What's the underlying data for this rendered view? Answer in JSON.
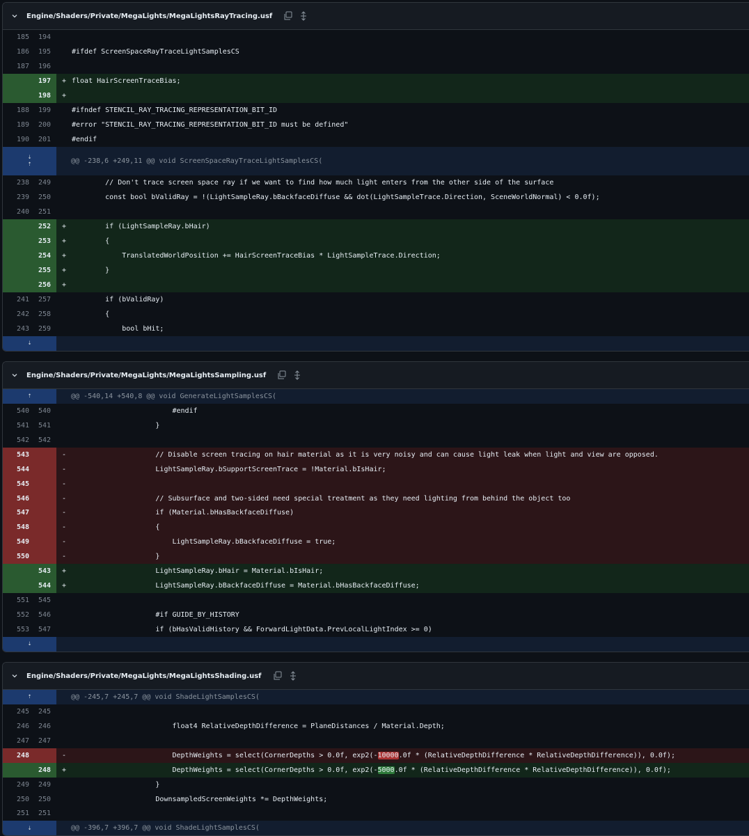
{
  "files": [
    {
      "name": "Engine/Shaders/Private/MegaLights/MegaLightsRayTracing.usf",
      "rows": [
        {
          "t": "ctx",
          "o": "185",
          "n": "194",
          "s": "",
          "c": ""
        },
        {
          "t": "ctx",
          "o": "186",
          "n": "195",
          "s": "",
          "c": "#ifdef ScreenSpaceRayTraceLightSamplesCS"
        },
        {
          "t": "ctx",
          "o": "187",
          "n": "196",
          "s": "",
          "c": ""
        },
        {
          "t": "add",
          "o": "",
          "n": "197",
          "s": "+",
          "c": "float HairScreenTraceBias;"
        },
        {
          "t": "add",
          "o": "",
          "n": "198",
          "s": "+",
          "c": ""
        },
        {
          "t": "ctx",
          "o": "188",
          "n": "199",
          "s": "",
          "c": "#ifndef STENCIL_RAY_TRACING_REPRESENTATION_BIT_ID"
        },
        {
          "t": "ctx",
          "o": "189",
          "n": "200",
          "s": "",
          "c": "#error \"STENCIL_RAY_TRACING_REPRESENTATION_BIT_ID must be defined\""
        },
        {
          "t": "ctx",
          "o": "190",
          "n": "201",
          "s": "",
          "c": "#endif"
        },
        {
          "t": "hunk2",
          "c": "@@ -238,6 +249,11 @@ void ScreenSpaceRayTraceLightSamplesCS("
        },
        {
          "t": "ctx",
          "o": "238",
          "n": "249",
          "s": "",
          "c": "        // Don't trace screen space ray if we want to find how much light enters from the other side of the surface"
        },
        {
          "t": "ctx",
          "o": "239",
          "n": "250",
          "s": "",
          "c": "        const bool bValidRay = !(LightSampleRay.bBackfaceDiffuse && dot(LightSampleTrace.Direction, SceneWorldNormal) < 0.0f);"
        },
        {
          "t": "ctx",
          "o": "240",
          "n": "251",
          "s": "",
          "c": ""
        },
        {
          "t": "add",
          "o": "",
          "n": "252",
          "s": "+",
          "c": "        if (LightSampleRay.bHair)"
        },
        {
          "t": "add",
          "o": "",
          "n": "253",
          "s": "+",
          "c": "        {"
        },
        {
          "t": "add",
          "o": "",
          "n": "254",
          "s": "+",
          "c": "            TranslatedWorldPosition += HairScreenTraceBias * LightSampleTrace.Direction;"
        },
        {
          "t": "add",
          "o": "",
          "n": "255",
          "s": "+",
          "c": "        }"
        },
        {
          "t": "add",
          "o": "",
          "n": "256",
          "s": "+",
          "c": ""
        },
        {
          "t": "ctx",
          "o": "241",
          "n": "257",
          "s": "",
          "c": "        if (bValidRay)"
        },
        {
          "t": "ctx",
          "o": "242",
          "n": "258",
          "s": "",
          "c": "        {"
        },
        {
          "t": "ctx",
          "o": "243",
          "n": "259",
          "s": "",
          "c": "            bool bHit;"
        },
        {
          "t": "hunkdown",
          "c": ""
        }
      ]
    },
    {
      "name": "Engine/Shaders/Private/MegaLights/MegaLightsSampling.usf",
      "rows": [
        {
          "t": "hunkup",
          "c": "@@ -540,14 +540,8 @@ void GenerateLightSamplesCS("
        },
        {
          "t": "ctx",
          "o": "540",
          "n": "540",
          "s": "",
          "c": "                        #endif"
        },
        {
          "t": "ctx",
          "o": "541",
          "n": "541",
          "s": "",
          "c": "                    }"
        },
        {
          "t": "ctx",
          "o": "542",
          "n": "542",
          "s": "",
          "c": ""
        },
        {
          "t": "del",
          "o": "543",
          "n": "",
          "s": "-",
          "c": "                    // Disable screen tracing on hair material as it is very noisy and can cause light leak when light and view are opposed."
        },
        {
          "t": "del",
          "o": "544",
          "n": "",
          "s": "-",
          "c": "                    LightSampleRay.bSupportScreenTrace = !Material.bIsHair;"
        },
        {
          "t": "del",
          "o": "545",
          "n": "",
          "s": "-",
          "c": ""
        },
        {
          "t": "del",
          "o": "546",
          "n": "",
          "s": "-",
          "c": "                    // Subsurface and two-sided need special treatment as they need lighting from behind the object too"
        },
        {
          "t": "del",
          "o": "547",
          "n": "",
          "s": "-",
          "c": "                    if (Material.bHasBackfaceDiffuse)"
        },
        {
          "t": "del",
          "o": "548",
          "n": "",
          "s": "-",
          "c": "                    {"
        },
        {
          "t": "del",
          "o": "549",
          "n": "",
          "s": "-",
          "c": "                        LightSampleRay.bBackfaceDiffuse = true;"
        },
        {
          "t": "del",
          "o": "550",
          "n": "",
          "s": "-",
          "c": "                    }"
        },
        {
          "t": "add",
          "o": "",
          "n": "543",
          "s": "+",
          "c": "                    LightSampleRay.bHair = Material.bIsHair;"
        },
        {
          "t": "add",
          "o": "",
          "n": "544",
          "s": "+",
          "c": "                    LightSampleRay.bBackfaceDiffuse = Material.bHasBackfaceDiffuse;"
        },
        {
          "t": "ctx",
          "o": "551",
          "n": "545",
          "s": "",
          "c": ""
        },
        {
          "t": "ctx",
          "o": "552",
          "n": "546",
          "s": "",
          "c": "                    #if GUIDE_BY_HISTORY"
        },
        {
          "t": "ctx",
          "o": "553",
          "n": "547",
          "s": "",
          "c": "                    if (bHasValidHistory && ForwardLightData.PrevLocalLightIndex >= 0)"
        },
        {
          "t": "hunkdown",
          "c": ""
        }
      ]
    },
    {
      "name": "Engine/Shaders/Private/MegaLights/MegaLightsShading.usf",
      "rows": [
        {
          "t": "hunkup",
          "c": "@@ -245,7 +245,7 @@ void ShadeLightSamplesCS("
        },
        {
          "t": "ctx",
          "o": "245",
          "n": "245",
          "s": "",
          "c": ""
        },
        {
          "t": "ctx",
          "o": "246",
          "n": "246",
          "s": "",
          "c": "                        float4 RelativeDepthDifference = PlaneDistances / Material.Depth;"
        },
        {
          "t": "ctx",
          "o": "247",
          "n": "247",
          "s": "",
          "c": ""
        },
        {
          "t": "del",
          "o": "248",
          "n": "",
          "s": "-",
          "c": "                        DepthWeights = select(CornerDepths > 0.0f, exp2(-10000.0f * (RelativeDepthDifference * RelativeDepthDifference)), 0.0f);",
          "hl": "10000"
        },
        {
          "t": "add",
          "o": "",
          "n": "248",
          "s": "+",
          "c": "                        DepthWeights = select(CornerDepths > 0.0f, exp2(-5000.0f * (RelativeDepthDifference * RelativeDepthDifference)), 0.0f);",
          "hl": "5000"
        },
        {
          "t": "ctx",
          "o": "249",
          "n": "249",
          "s": "",
          "c": "                    }"
        },
        {
          "t": "ctx",
          "o": "250",
          "n": "250",
          "s": "",
          "c": "                    DownsampledScreenWeights *= DepthWeights;"
        },
        {
          "t": "ctx",
          "o": "251",
          "n": "251",
          "s": "",
          "c": ""
        },
        {
          "t": "hunkdown",
          "c": "@@ -396,7 +396,7 @@ void ShadeLightSamplesCS("
        }
      ]
    }
  ]
}
